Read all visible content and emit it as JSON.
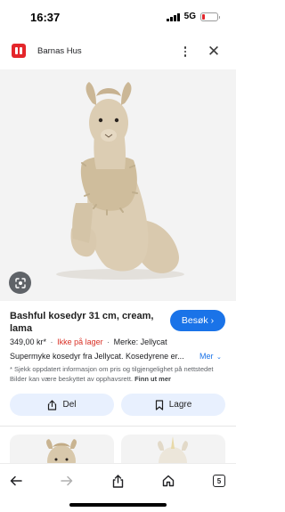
{
  "status_bar": {
    "time": "16:37",
    "network": "5G",
    "battery_level": 0.2,
    "battery_color": "#e2262c"
  },
  "header": {
    "site_name": "Barnas Hus",
    "logo_color": "#e4262b",
    "more_icon": "more-vert-icon",
    "close_icon": "close-icon",
    "close_glyph": "✕"
  },
  "image_area": {
    "lens_icon": "google-lens-icon"
  },
  "product": {
    "title": "Bashful kosedyr 31 cm, cream, lama",
    "visit_label": "Besøk",
    "visit_chevron": "›",
    "price": "349,00 kr*",
    "separator": "·",
    "stock_status": "Ikke på lager",
    "brand": "Merke: Jellycat",
    "description": "Supermyke kosedyr fra Jellycat. Kosedyrene er...",
    "more_label": "Mer",
    "more_chevron": "⌄",
    "disclaimer": "* Sjekk oppdatert informasjon om pris og tilgjengelighet på nettstedet Bilder kan være beskyttet av opphavsrett.",
    "learn_more": "Finn ut mer",
    "accent_color": "#1a73e8",
    "stock_color": "#d93025"
  },
  "actions": {
    "share_label": "Del",
    "save_label": "Lagre"
  },
  "bottom_nav": {
    "tab_count": "5",
    "icons": [
      "back-arrow-icon",
      "forward-arrow-icon",
      "share-icon",
      "home-icon",
      "tabs-icon"
    ]
  }
}
